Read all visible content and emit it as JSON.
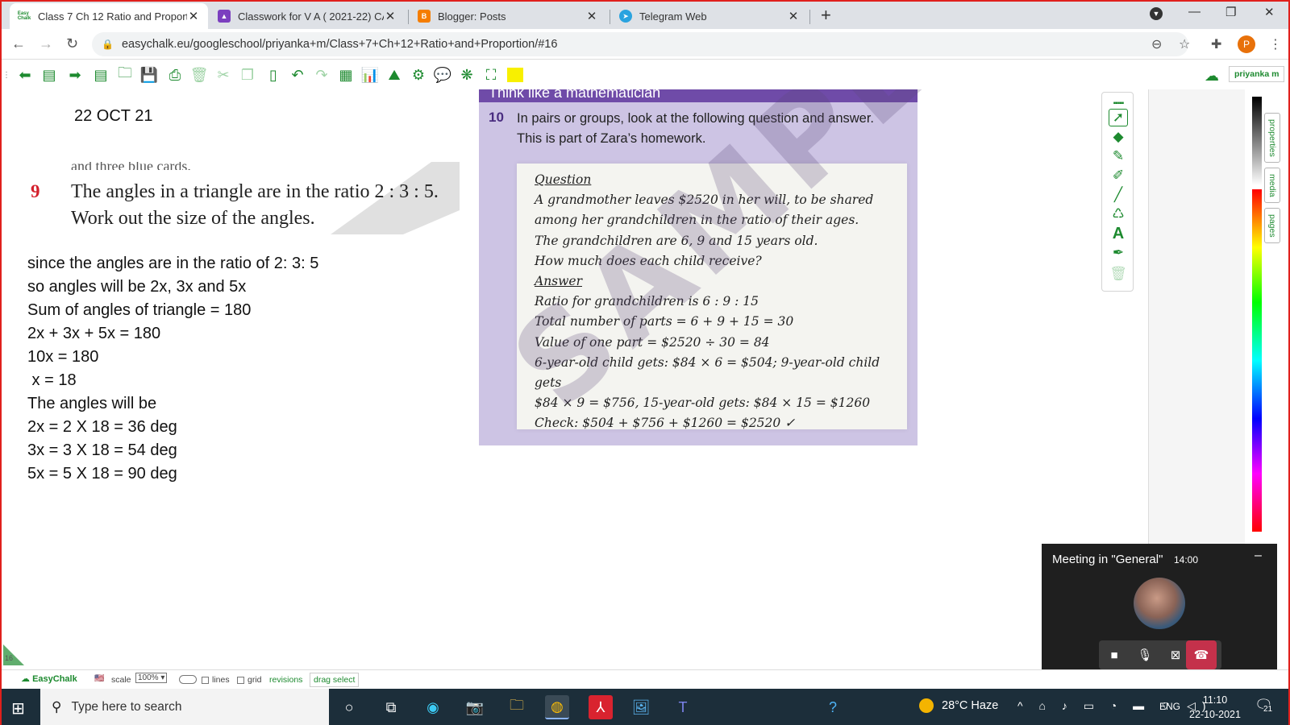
{
  "browser": {
    "tabs": [
      {
        "title": "Class 7 Ch 12 Ratio and Proportic",
        "icon": "easychalk-icon",
        "color": "#1d8a2f",
        "favtext": "Easy Chalk"
      },
      {
        "title": "Classwork for V A ( 2021-22) CAN",
        "icon": "classroom-icon",
        "color": "#7b3fbf",
        "favtext": ""
      },
      {
        "title": "Blogger: Posts",
        "icon": "blogger-icon",
        "color": "#f57d00",
        "favtext": "B"
      },
      {
        "title": "Telegram Web",
        "icon": "telegram-icon",
        "color": "#2aa3df",
        "favtext": "➤"
      }
    ],
    "url": "easychalk.eu/googleschool/priyanka+m/Class+7+Ch+12+Ratio+and+Proportion/#16",
    "profile_initial": "P"
  },
  "easychalk": {
    "user": "priyanka m",
    "date": "22 OCT 21",
    "page_number": "16",
    "status": {
      "logo": "EasyChalk",
      "scale_label": "scale",
      "scale_value": "100%",
      "lines": "lines",
      "grid": "grid",
      "revisions": "revisions",
      "drag_select": "drag select"
    },
    "side_tabs": [
      "properties",
      "media",
      "pages"
    ]
  },
  "question9": {
    "cut_text": "and three blue cards.",
    "number": "9",
    "line1": "The angles in a triangle are in the ratio 2 : 3 : 5.",
    "line2": "Work out the size of the angles."
  },
  "solution": [
    "since the angles are in the ratio of 2: 3: 5",
    "so angles will be 2x, 3x and 5x",
    "Sum of angles of triangle = 180",
    "2x + 3x + 5x = 180",
    "10x = 180",
    " x = 18",
    "The angles will be",
    "2x = 2 X 18 = 36 deg",
    "3x = 3 X 18 = 54 deg",
    "5x = 5 X 18 = 90 deg"
  ],
  "book": {
    "header": "Think like a mathematician",
    "qnum": "10",
    "intro1": "In pairs or groups, look at the following question and answer.",
    "intro2": "This is part of Zara’s homework.",
    "watermark": "SAMPLE",
    "homework": {
      "q_heading": "Question",
      "q1": "A grandmother leaves $2520 in her will, to be shared",
      "q2": "among her grandchildren in the ratio of their ages.",
      "q3": "The grandchildren are 6, 9 and 15 years old.",
      "q4": "How much does each child receive?",
      "a_heading": "Answer",
      "a1": "Ratio for grandchildren is 6 : 9 : 15",
      "a2": "Total number of parts = 6 + 9 + 15 = 30",
      "a3": "Value of one part = $2520 ÷ 30 = 84",
      "a4": "6-year-old child gets: $84 × 6 = $504; 9-year-old child gets",
      "a5": "$84 × 9 = $756, 15-year-old gets: $84 × 15 = $1260",
      "a6": "Check: $504 + $756 + $1260 = $2520 ✓"
    }
  },
  "teams": {
    "title": "Meeting in \"General\"",
    "time": "14:00"
  },
  "taskbar": {
    "search_placeholder": "Type here to search",
    "weather": "28°C  Haze",
    "lang": "ENG",
    "time": "11:10",
    "date": "22-10-2021",
    "notifications": "21"
  }
}
